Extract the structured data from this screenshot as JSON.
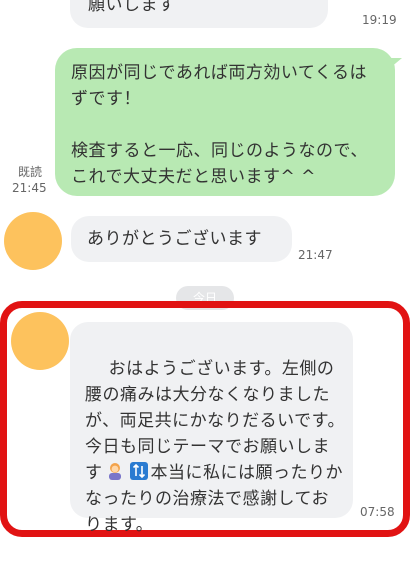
{
  "messages": {
    "top_incoming": {
      "text": "願いします",
      "time": "19:19"
    },
    "outgoing": {
      "text": "原因が同じであれば両方効いてくるはずです！\n\n検査すると一応、同じのようなので、これで大丈夫だと思います^ ^",
      "read_label": "既読",
      "time": "21:45"
    },
    "thanks": {
      "text": "ありがとうございます",
      "time": "21:47"
    },
    "date_separator": "今日",
    "latest": {
      "text_part1": "おはようございます。左側の腰の痛みは大分なくなりましたが、両足共にかなりだるいです。今日も同じテーマでお願いします",
      "text_part2": "本当に私には願ったりかなったりの治療法で感謝しております。",
      "time": "07:58"
    }
  },
  "colors": {
    "incoming_bubble": "#f0f1f3",
    "outgoing_bubble": "#b8e9b3",
    "avatar": "#fdc25d",
    "highlight": "#e11313"
  }
}
